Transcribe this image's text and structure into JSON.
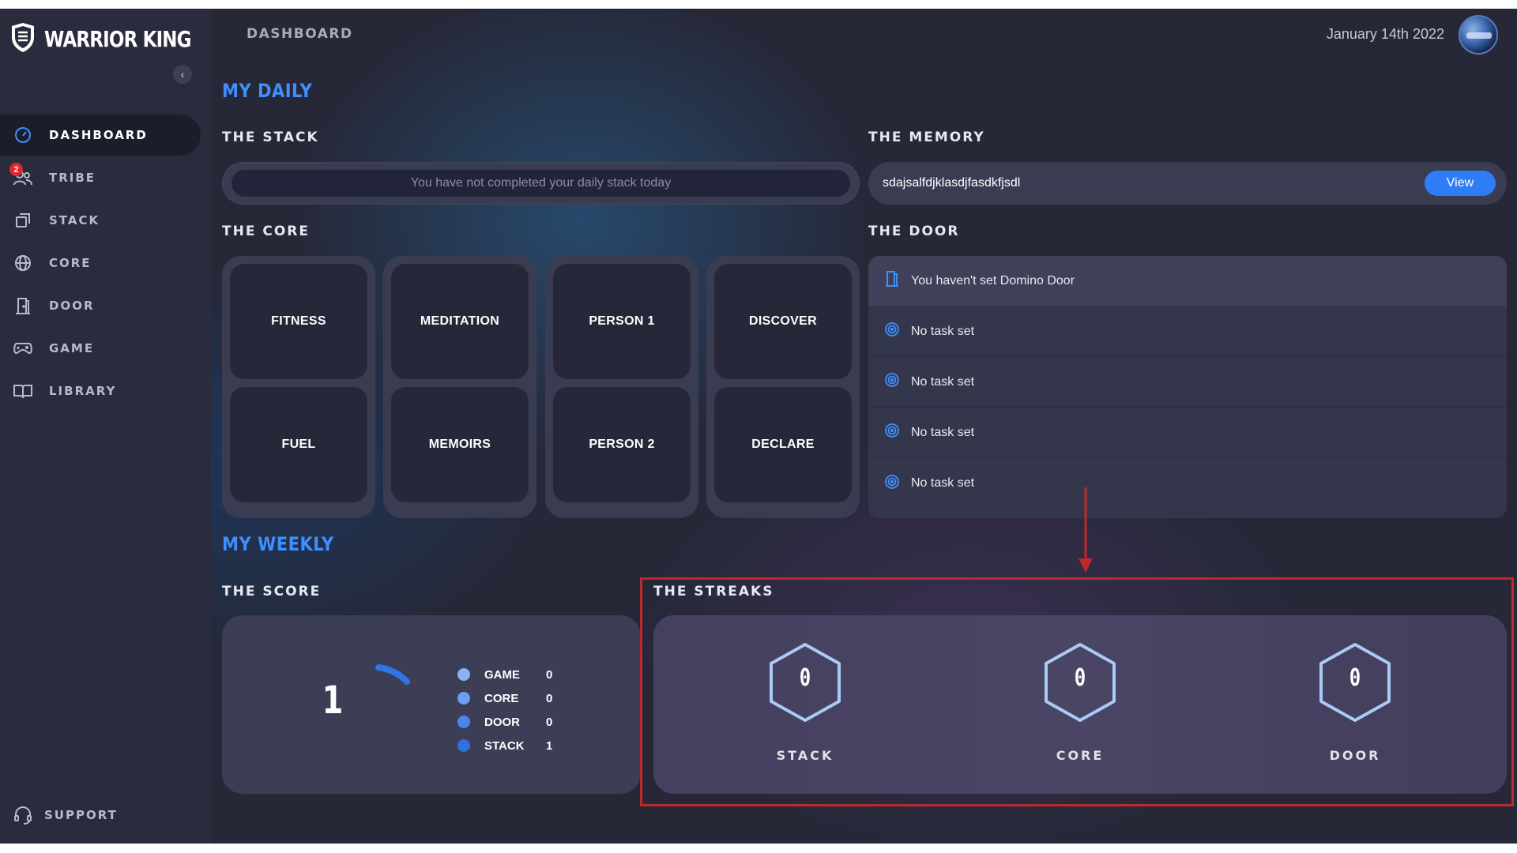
{
  "brand": {
    "name": "WARRIOR KING"
  },
  "header": {
    "title": "DASHBOARD",
    "date": "January 14th 2022"
  },
  "sidebar": {
    "items": [
      {
        "label": "DASHBOARD",
        "icon": "gauge-icon",
        "active": true
      },
      {
        "label": "TRIBE",
        "icon": "users-icon",
        "badge": "2"
      },
      {
        "label": "STACK",
        "icon": "copy-icon"
      },
      {
        "label": "CORE",
        "icon": "globe-icon"
      },
      {
        "label": "DOOR",
        "icon": "door-icon"
      },
      {
        "label": "GAME",
        "icon": "gamepad-icon"
      },
      {
        "label": "LIBRARY",
        "icon": "book-icon"
      }
    ],
    "support": {
      "label": "SUPPORT",
      "icon": "headset-icon"
    }
  },
  "daily": {
    "title": "MY DAILY",
    "stack": {
      "title": "THE STACK",
      "message": "You have not completed your daily stack today"
    },
    "memory": {
      "title": "THE MEMORY",
      "text": "sdajsalfdjklasdjfasdkfjsdl",
      "view_label": "View"
    },
    "core": {
      "title": "THE CORE",
      "columns": [
        [
          "FITNESS",
          "FUEL"
        ],
        [
          "MEDITATION",
          "MEMOIRS"
        ],
        [
          "PERSON 1",
          "PERSON 2"
        ],
        [
          "DISCOVER",
          "DECLARE"
        ]
      ]
    },
    "door": {
      "title": "THE DOOR",
      "domino": "You haven't set Domino Door",
      "tasks": [
        "No task set",
        "No task set",
        "No task set",
        "No task set"
      ]
    }
  },
  "weekly": {
    "title": "MY WEEKLY",
    "score": {
      "title": "THE SCORE",
      "total": "1",
      "legend": [
        {
          "label": "GAME",
          "value": "0",
          "color": "#8ab4f0"
        },
        {
          "label": "CORE",
          "value": "0",
          "color": "#6aa0f0"
        },
        {
          "label": "DOOR",
          "value": "0",
          "color": "#4a86ec"
        },
        {
          "label": "STACK",
          "value": "1",
          "color": "#2f6fe0"
        }
      ],
      "gauge_color": "#2f74e8"
    },
    "streaks": {
      "title": "THE STREAKS",
      "items": [
        {
          "label": "STACK",
          "value": "0"
        },
        {
          "label": "CORE",
          "value": "0"
        },
        {
          "label": "DOOR",
          "value": "0"
        }
      ]
    }
  },
  "colors": {
    "accent": "#3f8fff",
    "button": "#2f7cf6",
    "annotation": "#c0282a"
  }
}
